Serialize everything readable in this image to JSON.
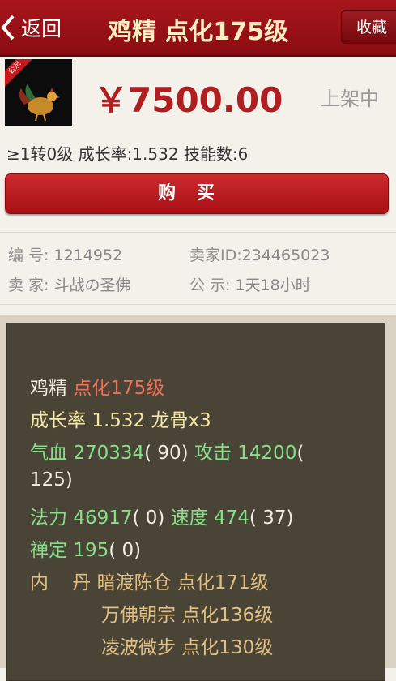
{
  "header": {
    "back_label": "返回",
    "title": "鸡精 点化175级",
    "favorite_label": "收藏"
  },
  "item": {
    "ribbon_text": "公示",
    "price": "￥7500.00",
    "status": "上架中",
    "attributes": "≥1转0级 成长率:1.532 技能数:6",
    "buy_label": "购买"
  },
  "info": {
    "id_key": "编  号:",
    "id_value": "1214952",
    "seller_id_key": "卖家ID:",
    "seller_id_value": "234465023",
    "seller_key": "卖  家:",
    "seller_value": "斗战の圣佛",
    "notice_key": "公  示:",
    "notice_value": "1天18小时"
  },
  "details": {
    "name": "鸡精",
    "name_level": "点化175级",
    "growth_label": "成长率",
    "growth_value": "1.532 龙骨x3",
    "hp_label": "气血",
    "hp_value": "270334",
    "hp_extra": "( 90)",
    "atk_label": "攻击",
    "atk_value": "14200",
    "atk_extra_a": "(",
    "atk_extra_b": "125)",
    "mp_label": "法力",
    "mp_value": "46917",
    "mp_extra": "( 0)",
    "spd_label": "速度",
    "spd_value": "474",
    "spd_extra": "( 37)",
    "chan_label": "禅定",
    "chan_value": "195",
    "chan_extra": "( 0)",
    "neidan_label": "内    丹",
    "neidan_items": [
      "暗渡陈仓 点化171级",
      "万佛朝宗 点化136级",
      "凌波微步 点化130级"
    ]
  },
  "colors": {
    "header_red": "#a8161c",
    "title_gold": "#ffeec2",
    "price_red": "#b01e22",
    "panel_bg": "#4a4436",
    "stat_green": "#86e08a",
    "level_red": "#f06f58",
    "neidan_tan": "#e1bf82"
  },
  "icons": [
    "chevron-left-icon",
    "rooster-icon"
  ]
}
